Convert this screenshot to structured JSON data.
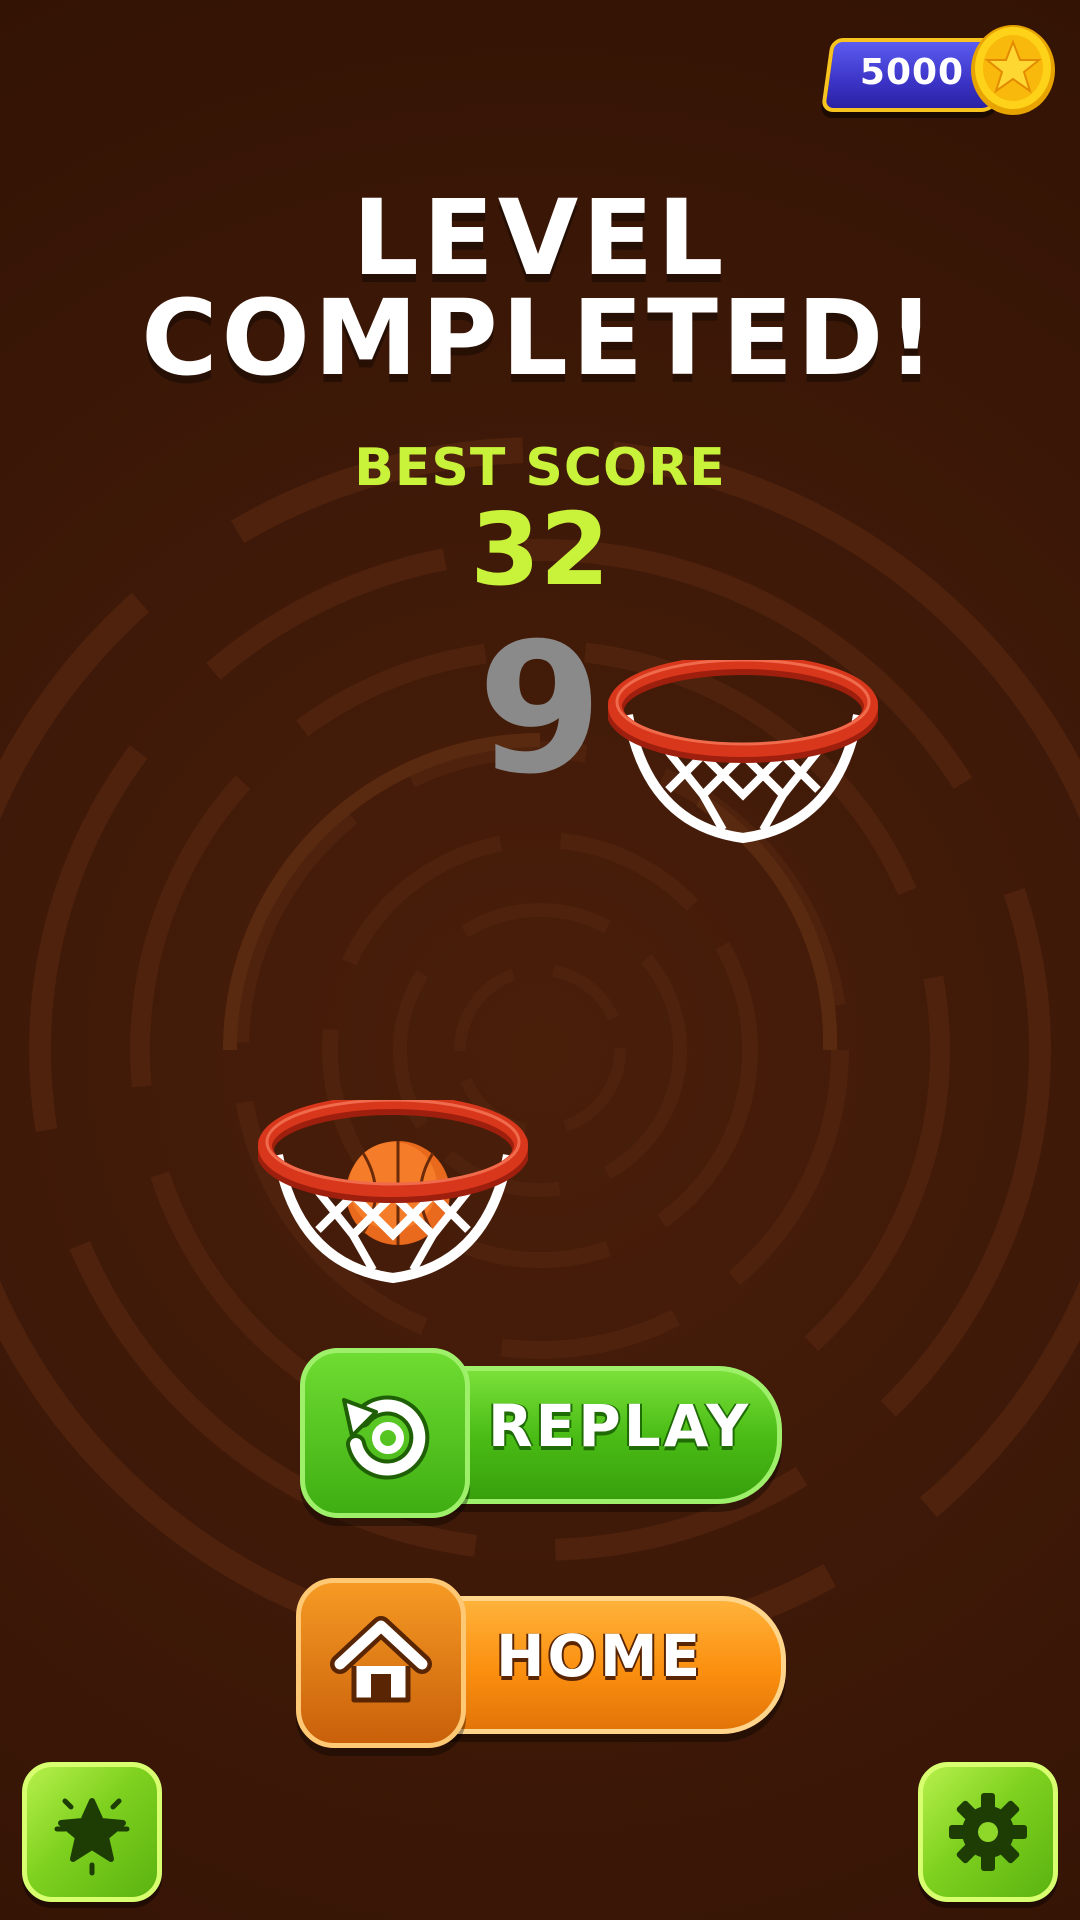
{
  "coins": {
    "value": "5000",
    "icon": "star-coin-icon"
  },
  "result": {
    "title_line1": "LEVEL",
    "title_line2": "COMPLETED!",
    "best_score_label": "BEST SCORE",
    "best_score_value": "32",
    "current_score": "9"
  },
  "buttons": {
    "replay_label": "REPLAY",
    "replay_icon": "replay-arrow-icon",
    "home_label": "HOME",
    "home_icon": "home-icon",
    "rate_icon": "star-badge-icon",
    "settings_icon": "gear-icon"
  },
  "colors": {
    "background": "#3f1908",
    "title": "#ffffff",
    "best_score": "#c9f23a",
    "current_score": "#8a8a8a",
    "replay_button": "#4bbd16",
    "home_button": "#fb8f0f",
    "coin_pill": "#3c34c7",
    "coin_gold": "#f6c31f",
    "rim_red": "#d8371c"
  }
}
